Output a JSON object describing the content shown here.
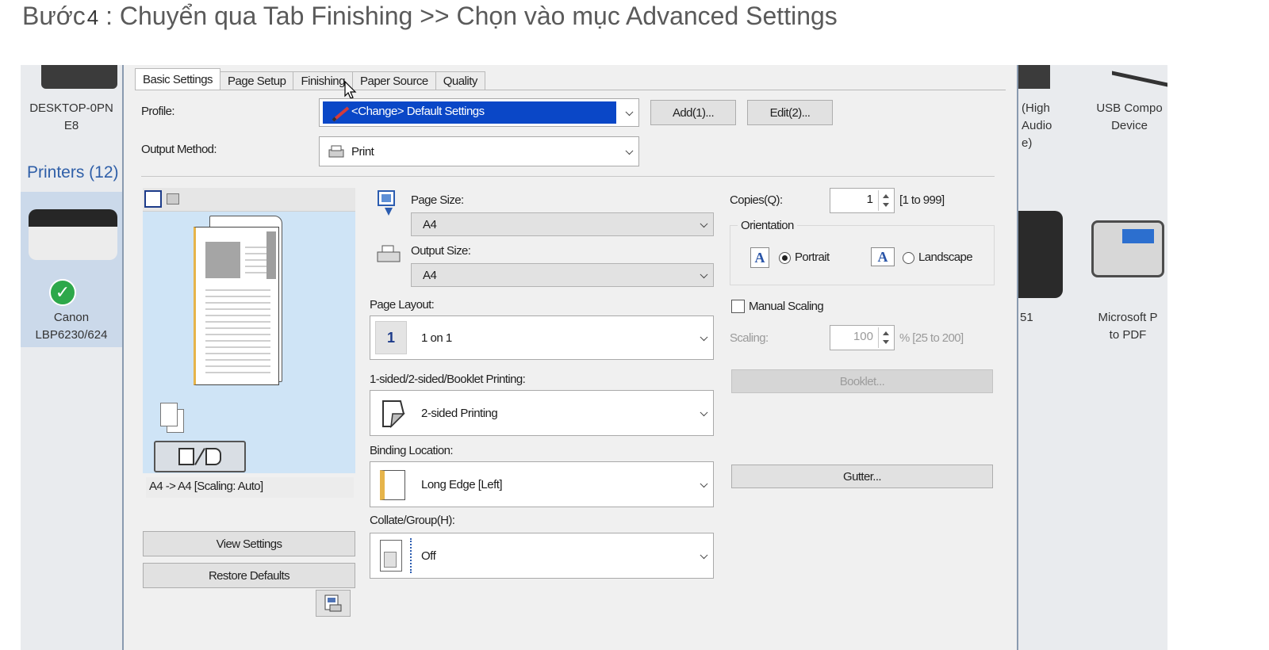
{
  "heading": {
    "step_word": "Bước",
    "step_number": "4",
    "text": " : Chuyển qua Tab Finishing >> Chọn vào mục Advanced Settings"
  },
  "background": {
    "left_device_name": "DESKTOP-0PN",
    "left_device_sub": "E8",
    "printers_group": "Printers (12)",
    "left_printer_name": "Canon",
    "left_printer_model": "LBP6230/624",
    "right_device_1a": "(High",
    "right_device_1b": "Audio",
    "right_device_1c": "e)",
    "right_device_2a": "USB Compo",
    "right_device_2b": "Device",
    "right_printer_suffix": "51",
    "right_printer_2a": "Microsoft P",
    "right_printer_2b": "to PDF"
  },
  "tabs": [
    "Basic Settings",
    "Page Setup",
    "Finishing",
    "Paper Source",
    "Quality"
  ],
  "profile": {
    "label": "Profile:",
    "value": "<Change> Default Settings",
    "add_button": "Add(1)...",
    "edit_button": "Edit(2)..."
  },
  "output_method": {
    "label": "Output Method:",
    "value": "Print"
  },
  "page_size": {
    "label": "Page Size:",
    "value": "A4"
  },
  "output_size": {
    "label": "Output Size:",
    "value": "A4"
  },
  "page_layout": {
    "label": "Page Layout:",
    "value": "1 on 1",
    "icon_text": "1"
  },
  "printing_mode": {
    "label": "1-sided/2-sided/Booklet Printing:",
    "value": "2-sided Printing"
  },
  "binding": {
    "label": "Binding Location:",
    "value": "Long Edge [Left]"
  },
  "collate": {
    "label": "Collate/Group(H):",
    "value": "Off"
  },
  "copies": {
    "label": "Copies(Q):",
    "value": "1",
    "range": "[1 to 999]"
  },
  "orientation": {
    "label": "Orientation",
    "portrait": "Portrait",
    "landscape": "Landscape",
    "icon_letter": "A"
  },
  "manual_scaling": {
    "label": "Manual Scaling"
  },
  "scaling": {
    "label": "Scaling:",
    "value": "100",
    "range": "% [25 to 200]"
  },
  "buttons": {
    "booklet": "Booklet...",
    "gutter": "Gutter...",
    "view_settings": "View Settings",
    "restore_defaults": "Restore Defaults"
  },
  "preview": {
    "caption": "A4 -> A4 [Scaling: Auto]"
  },
  "colors": {
    "selection": "#0a47c7",
    "preview_bg": "#cfe4f6",
    "dialog_bg": "#f0f0f0"
  }
}
